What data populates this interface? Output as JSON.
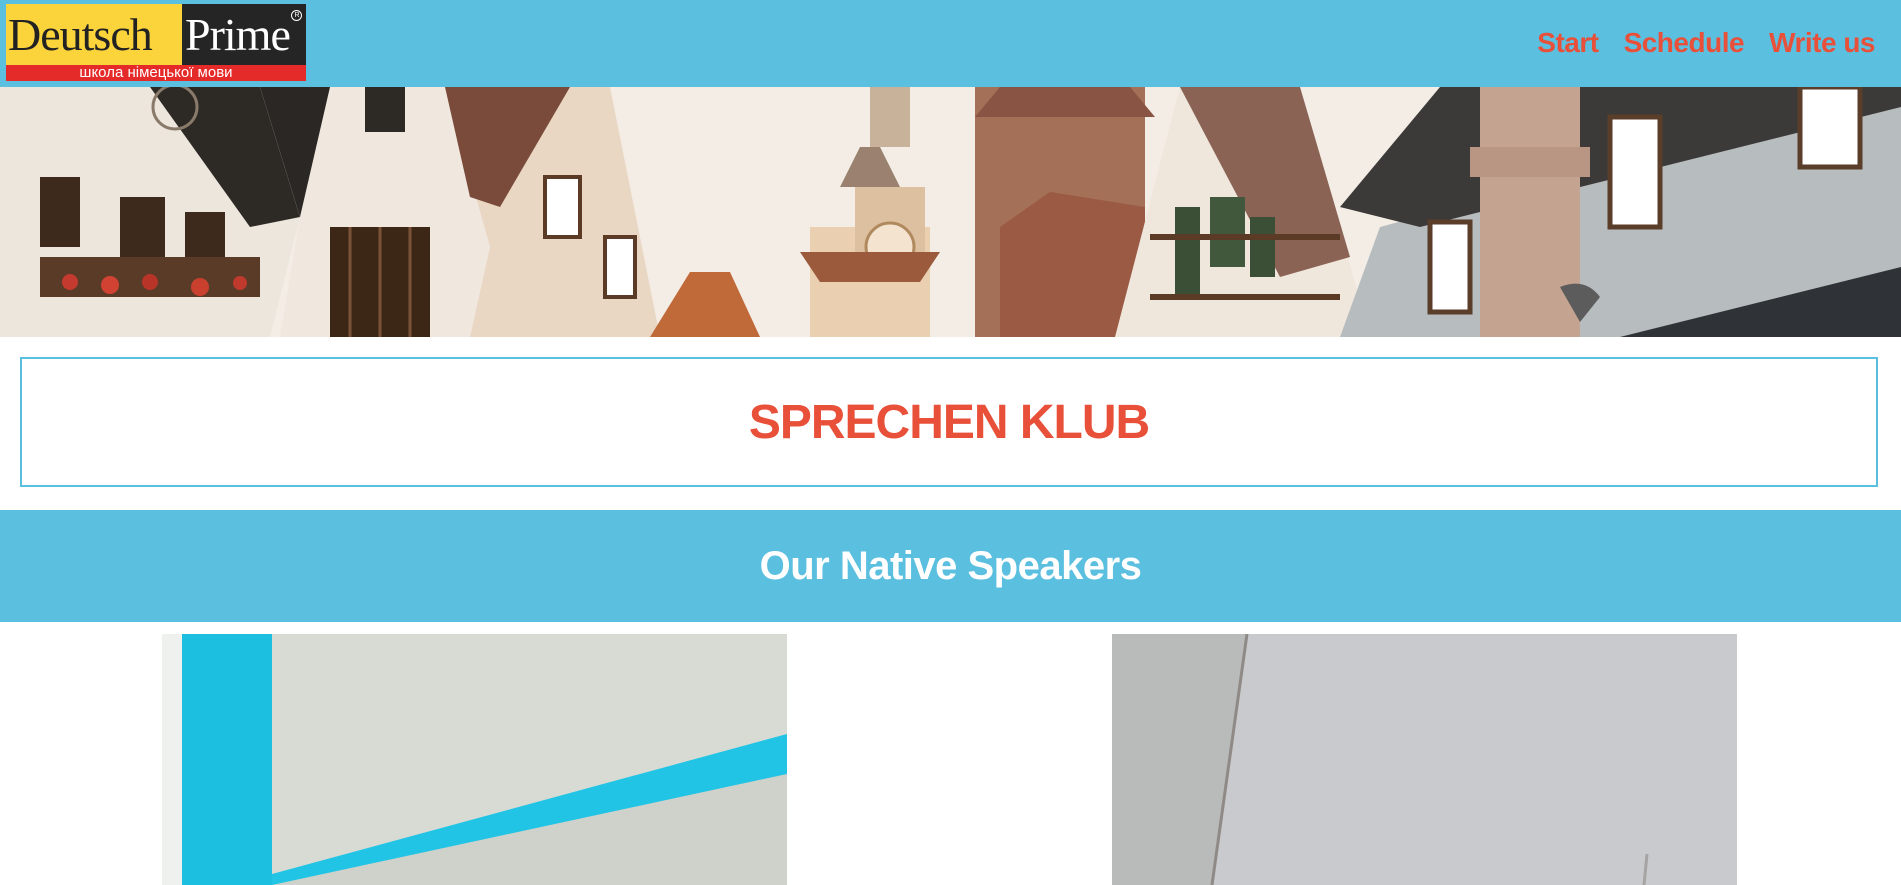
{
  "header": {
    "logo": {
      "word1": "Deutsch",
      "word2": "Prime",
      "registered": "R",
      "subtitle": "школа німецької мови"
    },
    "nav": [
      {
        "label": "Start"
      },
      {
        "label": "Schedule"
      },
      {
        "label": "Write us"
      }
    ]
  },
  "main": {
    "title": "SPRECHEN KLUB",
    "speakers_heading": "Our Native Speakers"
  },
  "colors": {
    "header_bg": "#5bbfdf",
    "accent_red": "#e8503a",
    "logo_yellow": "#fbd33a",
    "logo_dark": "#252525",
    "logo_red": "#e52a2a"
  }
}
